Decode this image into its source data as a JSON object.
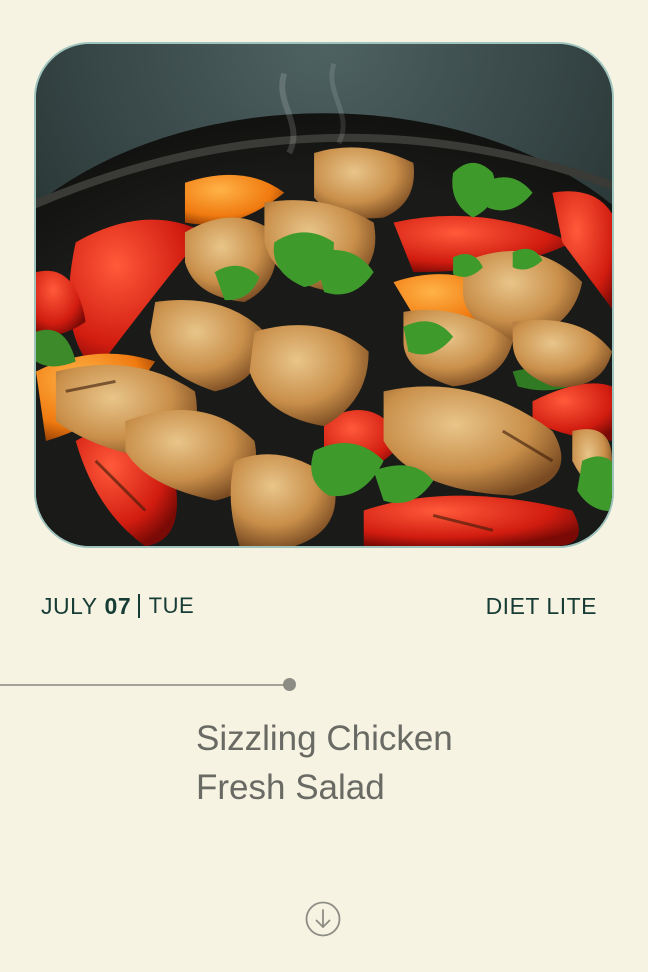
{
  "hero": {
    "image": "sizzling-chicken-skillet-photo"
  },
  "date": {
    "month": "JULY",
    "day": "07",
    "weekday": "TUE"
  },
  "diet": {
    "label": "DIET LITE"
  },
  "meal": {
    "title_line1": "Sizzling Chicken",
    "title_line2": "Fresh Salad"
  },
  "scroll_button": {
    "icon": "arrow-down-circle-icon"
  },
  "colors": {
    "background": "#f6f3e2",
    "text_dark": "#173c36",
    "text_gray": "#6a6a64",
    "image_border": "#9fc3bd"
  }
}
